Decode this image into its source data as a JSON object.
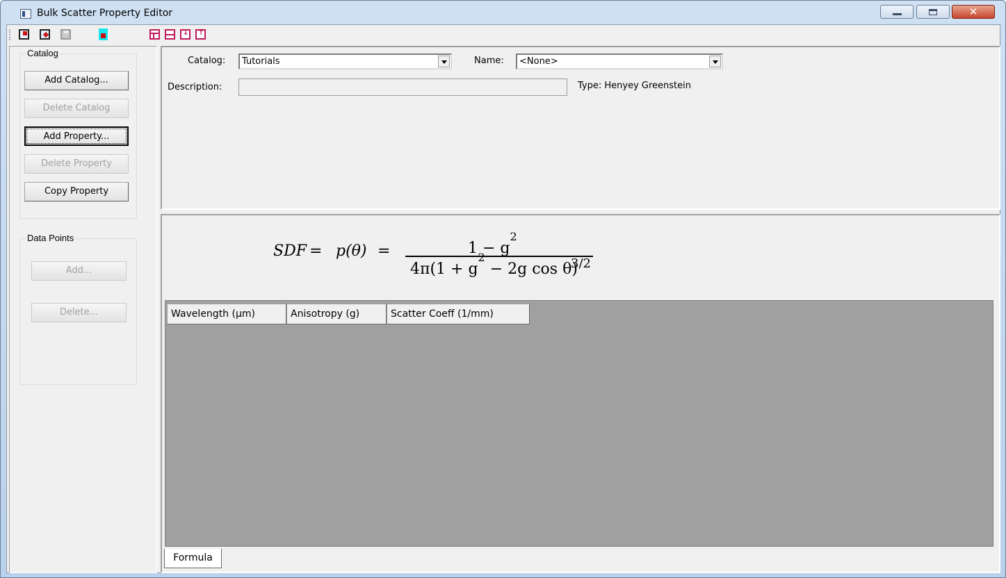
{
  "window": {
    "title": "Bulk Scatter Property Editor",
    "controls": {
      "minimize": "minimize",
      "maximize": "maximize",
      "close": "x"
    }
  },
  "toolbar": {
    "buttons": [
      {
        "id": "open",
        "icon": "open-icon"
      },
      {
        "id": "save-as",
        "icon": "save-as-icon"
      },
      {
        "id": "save",
        "icon": "save-icon",
        "enabled": false
      },
      {
        "id": "lock",
        "icon": "lock-icon"
      },
      {
        "id": "layout-1",
        "icon": "layout-icon"
      },
      {
        "id": "layout-2",
        "icon": "split-icon"
      },
      {
        "id": "expand",
        "icon": "expand-down-icon"
      },
      {
        "id": "collapse",
        "icon": "collapse-up-icon"
      }
    ]
  },
  "catalog_group": {
    "legend": "Catalog",
    "buttons": {
      "add_catalog": "Add Catalog...",
      "delete_catalog": "Delete Catalog",
      "add_property": "Add Property...",
      "delete_property": "Delete Property",
      "copy_property": "Copy Property"
    }
  },
  "data_points_group": {
    "legend": "Data Points",
    "buttons": {
      "add": "Add...",
      "delete": "Delete..."
    }
  },
  "header": {
    "catalog_label": "Catalog:",
    "catalog_value": "Tutorials",
    "name_label": "Name:",
    "name_value": "<None>",
    "description_label": "Description:",
    "description_value": "",
    "type_label": "Type: Henyey Greenstein"
  },
  "formula": {
    "lhs": "SDF",
    "eq1": "=",
    "p": "p(θ)",
    "eq2": "=",
    "numerator": "1 − g",
    "numerator_exp": "2",
    "denominator": "4π(1 + g",
    "denominator_exp": "2",
    "denominator_rest": " − 2g cos θ)",
    "outer_exp": "3/2"
  },
  "table": {
    "columns": [
      "Wavelength (µm)",
      "Anisotropy (g)",
      "Scatter Coeff (1/mm)"
    ],
    "rows": []
  },
  "tabs": [
    {
      "label": "Formula",
      "selected": true
    }
  ]
}
